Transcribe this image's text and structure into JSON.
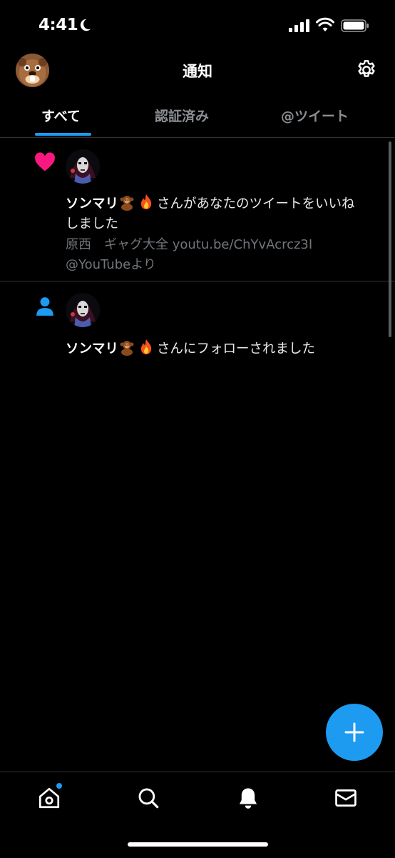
{
  "status_bar": {
    "time": "4:41"
  },
  "header": {
    "title": "通知"
  },
  "tabs": [
    {
      "label": "すべて",
      "active": true
    },
    {
      "label": "認証済み",
      "active": false
    },
    {
      "label": "@ツイート",
      "active": false
    }
  ],
  "notifications": [
    {
      "type": "like",
      "icon": "heart-icon",
      "user_name": "ソンマリ",
      "emojis": [
        "monkey-emoji",
        "fire-emoji"
      ],
      "action_text_1": "さんがあなたのツイートをいいね",
      "action_text_2": "しました",
      "quote_line_1": "原西　ギャグ大全 youtu.be/ChYvAcrcz3I",
      "quote_line_2": "@YouTubeより"
    },
    {
      "type": "follow",
      "icon": "person-icon",
      "user_name": "ソンマリ",
      "emojis": [
        "monkey-emoji",
        "fire-emoji"
      ],
      "action_text_1": "さんにフォローされました"
    }
  ],
  "fab": {
    "icon": "plus-icon"
  },
  "bottom_nav": [
    {
      "name": "home",
      "icon": "home-icon",
      "has_badge": true
    },
    {
      "name": "search",
      "icon": "search-icon"
    },
    {
      "name": "notifications",
      "icon": "bell-icon"
    },
    {
      "name": "messages",
      "icon": "mail-icon"
    }
  ],
  "colors": {
    "accent": "#1d9bf0",
    "like": "#f91880",
    "background": "#000000",
    "secondary_text": "#71767b"
  }
}
